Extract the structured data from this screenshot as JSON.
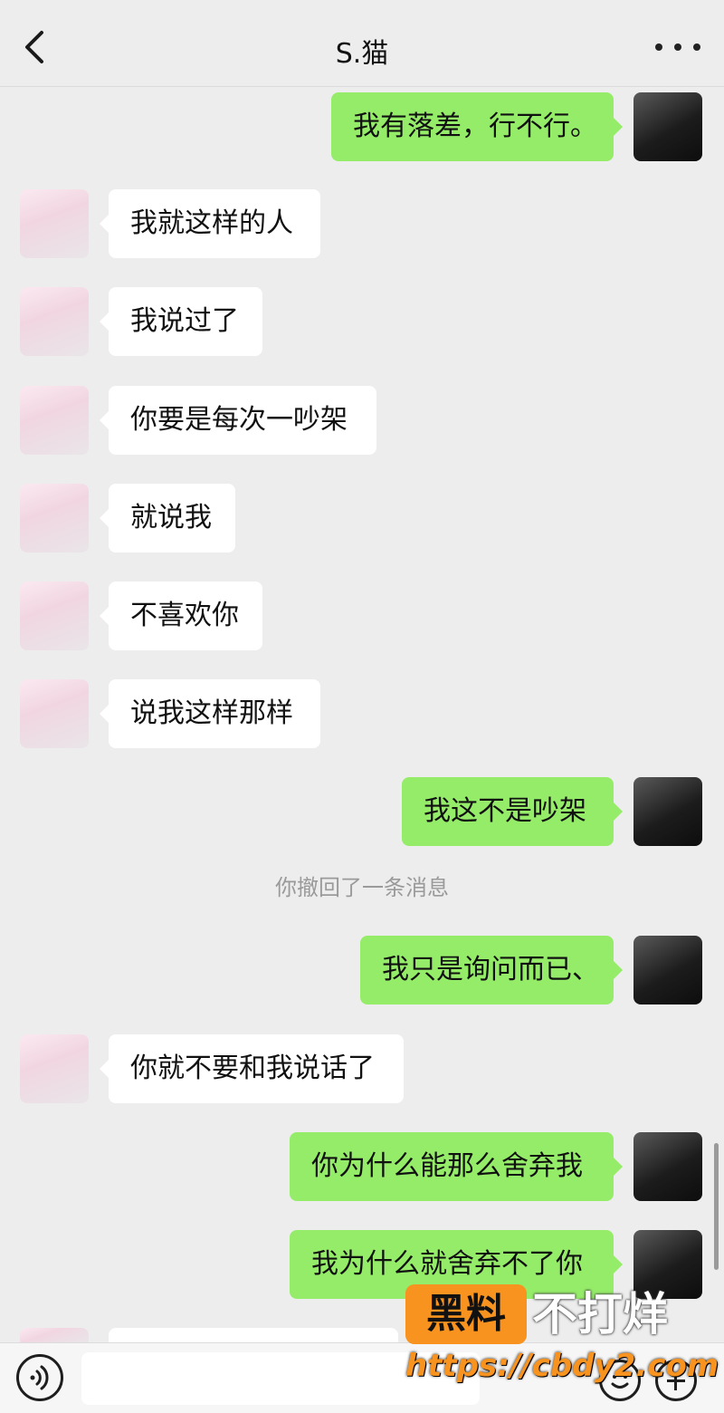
{
  "header": {
    "title": "S.猫",
    "back_icon": "chevron-left-icon",
    "more_icon": "more-dots-icon"
  },
  "messages": [
    {
      "side": "right",
      "text": "我有落差，行不行。"
    },
    {
      "side": "left",
      "text": "我就这样的人"
    },
    {
      "side": "left",
      "text": "我说过了"
    },
    {
      "side": "left",
      "text": "你要是每次一吵架"
    },
    {
      "side": "left",
      "text": "就说我"
    },
    {
      "side": "left",
      "text": "不喜欢你"
    },
    {
      "side": "left",
      "text": "说我这样那样"
    },
    {
      "side": "right",
      "text": "我这不是吵架"
    },
    {
      "side": "right",
      "text": "我只是询问而已、"
    },
    {
      "side": "left",
      "text": "你就不要和我说话了"
    },
    {
      "side": "right",
      "text": "你为什么能那么舍弃我"
    },
    {
      "side": "right",
      "text": "我为什么就舍弃不了你"
    }
  ],
  "system_note": "你撤回了一条消息",
  "input_bar": {
    "voice_icon": "voice-icon",
    "emoji_icon": "emoji-icon",
    "plus_icon": "plus-icon",
    "input_value": ""
  },
  "watermark": {
    "brand_box": "黑料",
    "brand_text": "不打烊",
    "url": "https://cbdy2.com"
  },
  "colors": {
    "background": "#ededed",
    "bubble_right": "#95ec69",
    "bubble_left": "#ffffff",
    "watermark_accent": "#f7931e"
  }
}
